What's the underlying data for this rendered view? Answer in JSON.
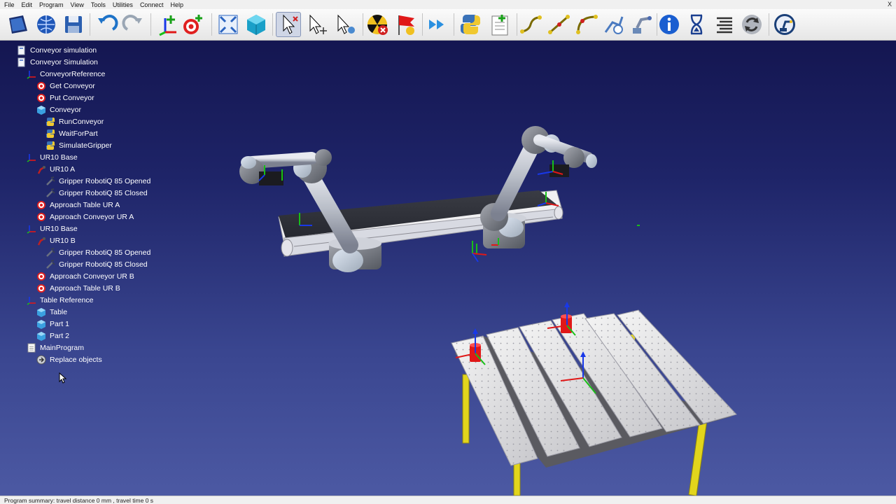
{
  "menu": [
    "File",
    "Edit",
    "Program",
    "View",
    "Tools",
    "Utilities",
    "Connect",
    "Help"
  ],
  "window_controls": {
    "close": "X"
  },
  "toolbar": [
    "open-station-icon",
    "online-library-icon",
    "save-icon",
    "undo-icon",
    "redo-icon",
    "add-reference-frame-icon",
    "add-target-icon",
    "fit-all-icon",
    "isometric-view-icon",
    "select-icon",
    "select-multiple-icon",
    "select-robot-icon",
    "collision-check-icon",
    "stop-flag-icon",
    "fast-simulation-icon",
    "python-script-icon",
    "new-program-icon",
    "joint-move-icon",
    "linear-move-icon",
    "circular-move-icon",
    "teach-target-icon",
    "robot-machining-icon",
    "info-icon",
    "pause-icon",
    "program-list-icon",
    "sync-icon",
    "robot-connect-icon"
  ],
  "tree": [
    {
      "label": "Conveyor simulation",
      "icon": "station-icon",
      "level": 0
    },
    {
      "label": "Conveyor Simulation",
      "icon": "station-icon",
      "level": 0
    },
    {
      "label": "ConveyorReference",
      "icon": "reference-frame-icon",
      "level": 1
    },
    {
      "label": "Get Conveyor",
      "icon": "target-icon",
      "level": 2
    },
    {
      "label": "Put Conveyor",
      "icon": "target-icon",
      "level": 2
    },
    {
      "label": "Conveyor",
      "icon": "object-icon",
      "level": 2
    },
    {
      "label": "RunConveyor",
      "icon": "python-icon",
      "level": 3
    },
    {
      "label": "WaitForPart",
      "icon": "python-icon",
      "level": 3
    },
    {
      "label": "SimulateGripper",
      "icon": "python-icon",
      "level": 3
    },
    {
      "label": "UR10 Base",
      "icon": "reference-frame-icon",
      "level": 1
    },
    {
      "label": "UR10 A",
      "icon": "robot-icon",
      "level": 2
    },
    {
      "label": "Gripper RobotiQ 85 Opened",
      "icon": "gripper-icon",
      "level": 3
    },
    {
      "label": "Gripper RobotiQ 85 Closed",
      "icon": "gripper-icon",
      "level": 3
    },
    {
      "label": "Approach Table UR A",
      "icon": "target-icon",
      "level": 2
    },
    {
      "label": "Approach Conveyor UR A",
      "icon": "target-icon",
      "level": 2
    },
    {
      "label": "UR10 Base",
      "icon": "reference-frame-icon",
      "level": 1
    },
    {
      "label": "UR10 B",
      "icon": "robot-icon",
      "level": 2
    },
    {
      "label": "Gripper RobotiQ 85 Opened",
      "icon": "gripper-icon",
      "level": 3
    },
    {
      "label": "Gripper RobotiQ 85 Closed",
      "icon": "gripper-icon",
      "level": 3
    },
    {
      "label": "Approach Conveyor UR B",
      "icon": "target-icon",
      "level": 2
    },
    {
      "label": "Approach Table UR B",
      "icon": "target-icon",
      "level": 2
    },
    {
      "label": "Table Reference",
      "icon": "reference-frame-icon",
      "level": 1
    },
    {
      "label": "Table",
      "icon": "object-icon",
      "level": 2
    },
    {
      "label": "Part 1",
      "icon": "object-icon",
      "level": 2
    },
    {
      "label": "Part 2",
      "icon": "object-icon",
      "level": 2
    },
    {
      "label": "MainProgram",
      "icon": "program-icon",
      "level": 1
    },
    {
      "label": "Replace objects",
      "icon": "subprogram-call-icon",
      "level": 2
    }
  ],
  "status": "Program summary: travel distance 0 mm , travel time 0 s",
  "colors": {
    "viewport_top": "#11124a",
    "viewport_bottom": "#4d5aa4",
    "axis_x": "#e01818",
    "axis_y": "#18c018",
    "axis_z": "#1838e8",
    "table_leg": "#e2d51c",
    "part": "#e01818"
  }
}
